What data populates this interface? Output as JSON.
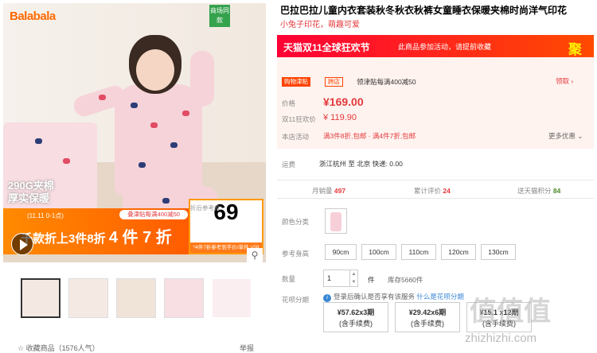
{
  "gallery": {
    "brand": "Balabala",
    "same_style": "商场同款",
    "badge_290": "290G夹棉",
    "badge_warm": "厚实保暖",
    "promo_date": "(11.11 0-1点)",
    "promo_tag": "叠津贴每满400减50",
    "promo_main": "千款折上3件8折",
    "promo_main2": "4 件 7 折",
    "price_label": "折后参考价",
    "price_value": "69",
    "price_sub": "*4件7折参考到手价/单件 >58",
    "zoom_icon": "magnifier-icon",
    "collect": "收藏商品",
    "collect_count": "（1576人气）",
    "report": "举报"
  },
  "product": {
    "title": "巴拉巴拉儿童内衣套装秋冬秋衣秋裤女童睡衣保暖夹棉时尚洋气印花",
    "subtitle": "小兔子印花，萌趣可爱",
    "banner_logo": "天猫双11全球狂欢节",
    "banner_info": "此商品参加活动，请提前收藏",
    "banner_ju": "聚",
    "tag_jt": "购物津贴",
    "tag_kd": "跨店",
    "jt_text": "领津贴每满400减50",
    "lingquan": "领取",
    "price_label": "价格",
    "price_now": "¥169.00",
    "d11_label": "双11狂欢价",
    "price_d11": "¥ 119.90",
    "activity_label": "本店活动",
    "activity": "满3件8折,包邮 · 满4件7折,包邮",
    "more": "更多优惠",
    "ship_label": "运费",
    "ship_text": "浙江杭州 至 北京 快递: 0.00",
    "sales_label": "月销量",
    "sales": "497",
    "reviews_label": "累计评价",
    "reviews": "24",
    "points_label": "送天猫积分",
    "points": "84",
    "color_label": "颜色分类",
    "size_label": "参考身高",
    "sizes": [
      "90cm",
      "100cm",
      "110cm",
      "120cm",
      "130cm"
    ],
    "qty_label": "数量",
    "qty": "1",
    "unit": "件",
    "stock": "库存5660件",
    "hb_label": "花呗分期",
    "hb_note": "登录后确认是否享有该服务",
    "hb_link": "什么是花呗分期",
    "hb_options": [
      {
        "top": "¥57.62x3期",
        "bottom": "(含手续费)"
      },
      {
        "top": "¥29.42x6期",
        "bottom": "(含手续费)"
      },
      {
        "top": "¥15.1 x12期",
        "bottom": "(含手续费)"
      }
    ]
  },
  "watermark": {
    "big": "值值值",
    "url": "zhizhizhi.com"
  }
}
